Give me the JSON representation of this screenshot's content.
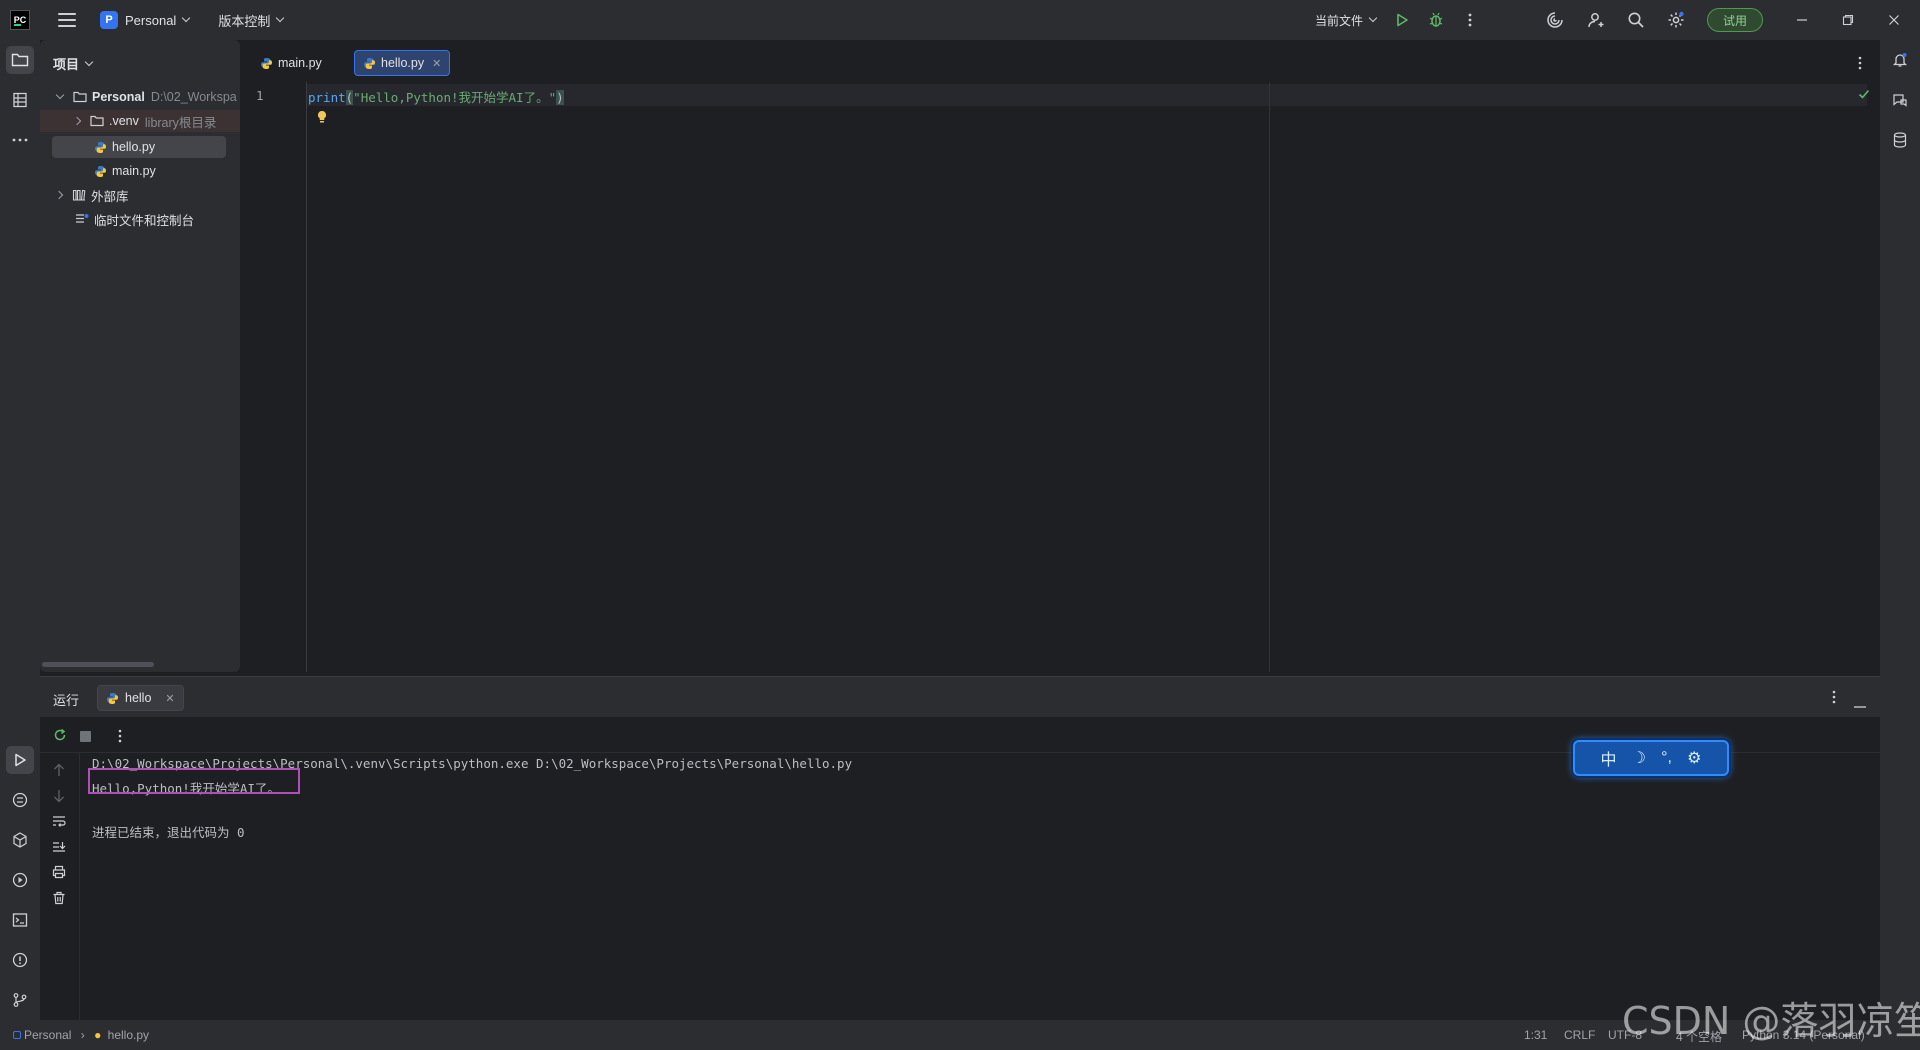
{
  "titlebar": {
    "logo": "PC",
    "project_badge": "P",
    "project_name": "Personal",
    "vcs_label": "版本控制",
    "run_config": "当前文件",
    "trial_label": "试用"
  },
  "project_panel": {
    "title": "项目",
    "tree": {
      "root_name": "Personal",
      "root_path": "D:\\02_Workspa",
      "venv_name": ".venv",
      "venv_hint": "library根目录",
      "file_hello": "hello.py",
      "file_main": "main.py",
      "external_libs": "外部库",
      "scratches": "临时文件和控制台"
    }
  },
  "editor": {
    "tabs": [
      {
        "label": "main.py",
        "active": false
      },
      {
        "label": "hello.py",
        "active": true
      }
    ],
    "line_number": "1",
    "code": {
      "fn": "print",
      "open_paren": "(",
      "string": "\"Hello,Python!我开始学AI了。\"",
      "close_paren": ")"
    }
  },
  "run_panel": {
    "title": "运行",
    "tab_label": "hello",
    "console": {
      "command": "D:\\02_Workspace\\Projects\\Personal\\.venv\\Scripts\\python.exe D:\\02_Workspace\\Projects\\Personal\\hello.py",
      "output": "Hello,Python!我开始学AI了。",
      "exit_message": "进程已结束，退出代码为 0"
    }
  },
  "ime": {
    "lang": "中",
    "moon": "☽",
    "punct": "°,",
    "settings": "⚙"
  },
  "statusbar": {
    "breadcrumb_project": "Personal",
    "breadcrumb_file": "hello.py",
    "position": "1:31",
    "line_sep": "CRLF",
    "encoding": "UTF-8",
    "indent": "4 个空格",
    "interpreter": "Python 3.14 (Personal)"
  },
  "watermark": "CSDN @落羽凉笙",
  "colors": {
    "accent": "#3574f0",
    "run_green": "#5fb865",
    "highlight_box": "#b04fb7"
  }
}
